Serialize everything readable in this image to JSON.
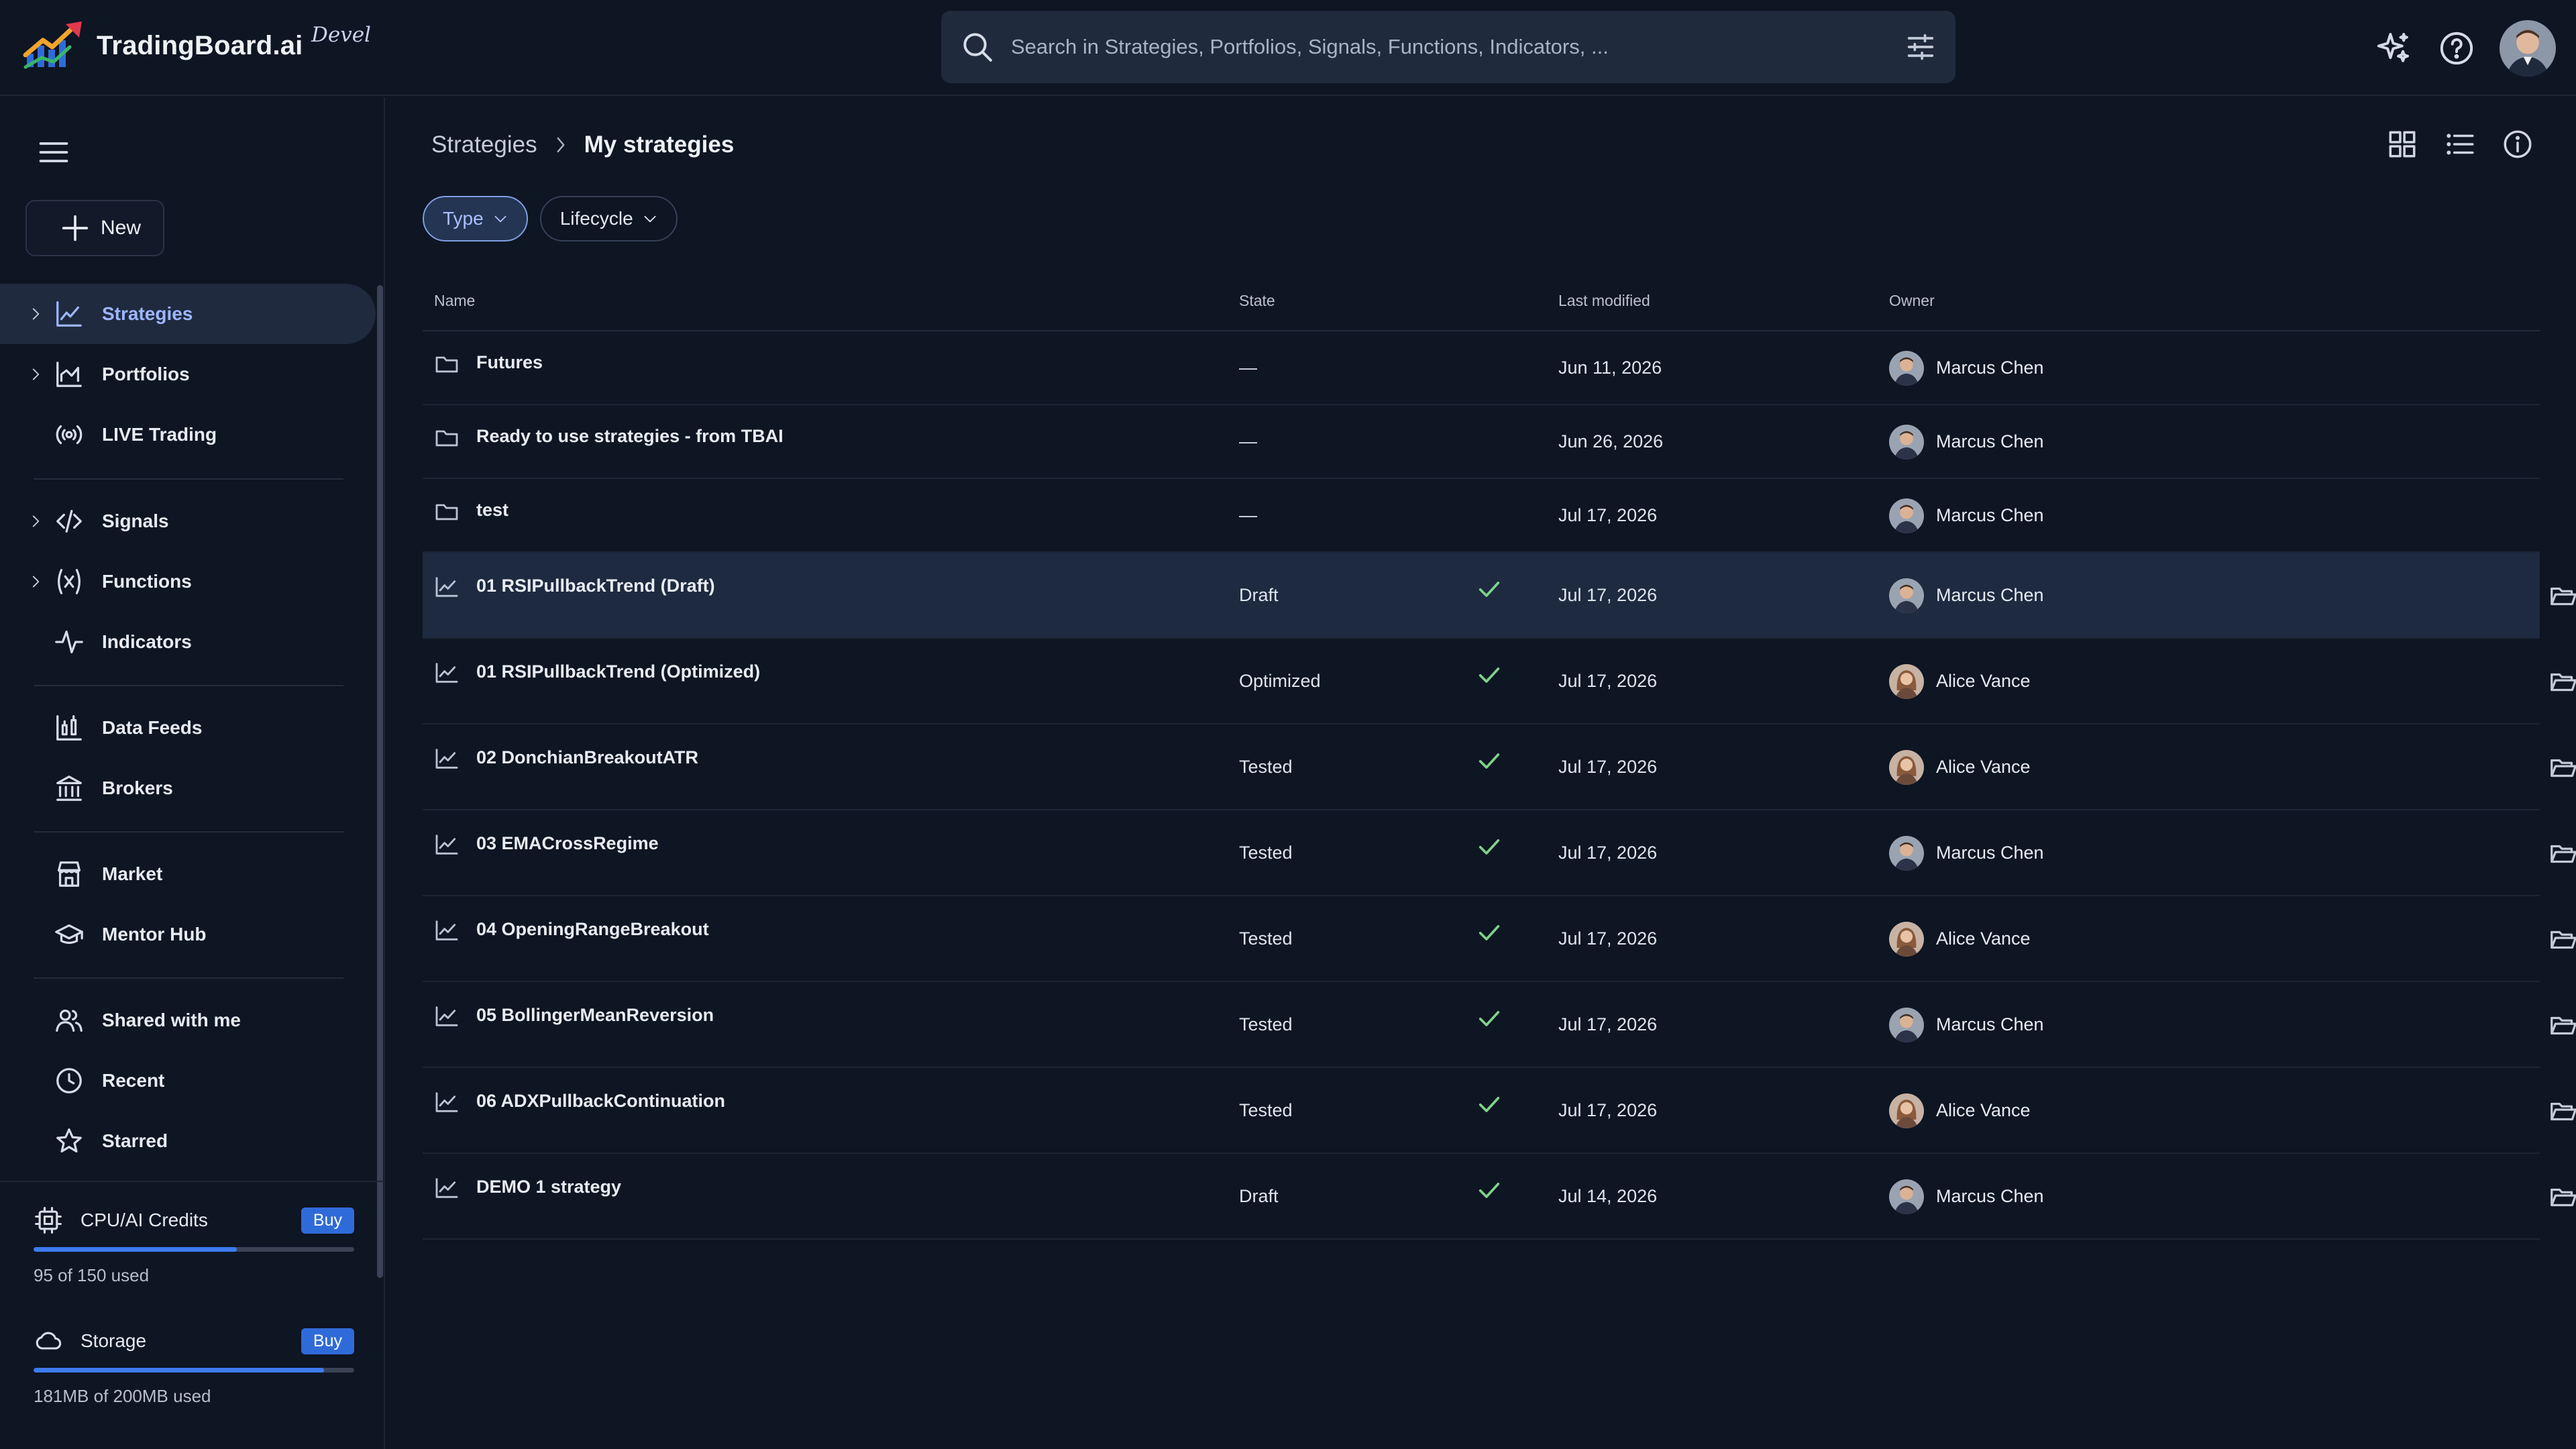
{
  "app": {
    "name": "TradingBoard.ai",
    "env": "Devel",
    "accent": "#3d7bf0",
    "logo_colors": [
      "#2f6bd8",
      "#e2384d",
      "#f0a52b",
      "#38b56a"
    ]
  },
  "search": {
    "placeholder": "Search in Strategies, Portfolios, Signals, Functions, Indicators, ...",
    "value": "",
    "icon": "search-icon",
    "filter_icon": "filter-settings-icon"
  },
  "header_actions": [
    "ai-sparkle-icon",
    "help-icon",
    "user-avatar"
  ],
  "sidebar": {
    "new_label": "New",
    "items": [
      {
        "label": "Strategies",
        "icon": "strategy-chart-icon",
        "expandable": true,
        "active": true
      },
      {
        "label": "Portfolios",
        "icon": "portfolio-chart-icon",
        "expandable": true
      },
      {
        "label": "LIVE Trading",
        "icon": "broadcast-icon",
        "expandable": false
      },
      {
        "label": "Signals",
        "icon": "code-icon",
        "expandable": true
      },
      {
        "label": "Functions",
        "icon": "function-icon",
        "expandable": true
      },
      {
        "label": "Indicators",
        "icon": "pulse-icon",
        "expandable": false
      },
      {
        "label": "Data Feeds",
        "icon": "data-feeds-icon",
        "expandable": false
      },
      {
        "label": "Brokers",
        "icon": "bank-icon",
        "expandable": false
      },
      {
        "label": "Market",
        "icon": "store-icon",
        "expandable": false
      },
      {
        "label": "Mentor Hub",
        "icon": "graduation-cap-icon",
        "expandable": false
      },
      {
        "label": "Shared with me",
        "icon": "people-icon",
        "expandable": false
      },
      {
        "label": "Recent",
        "icon": "clock-icon",
        "expandable": false
      },
      {
        "label": "Starred",
        "icon": "star-icon",
        "expandable": false
      }
    ],
    "quotas": [
      {
        "label": "CPU/AI Credits",
        "icon": "cpu-icon",
        "buy_label": "Buy",
        "used_text": "95 of 150 used",
        "fraction": 0.633
      },
      {
        "label": "Storage",
        "icon": "cloud-icon",
        "buy_label": "Buy",
        "used_text": "181MB of 200MB used",
        "fraction": 0.905
      }
    ]
  },
  "breadcrumb": {
    "parent": "Strategies",
    "current": "My strategies"
  },
  "view_actions": [
    "grid-view-icon",
    "list-view-icon",
    "info-icon"
  ],
  "filters": [
    {
      "label": "Type",
      "active": true
    },
    {
      "label": "Lifecycle",
      "active": false
    }
  ],
  "table": {
    "columns": [
      "Name",
      "State",
      "Last modified",
      "Owner"
    ],
    "rows": [
      {
        "kind": "folder",
        "name": "Futures",
        "state": "—",
        "validated": false,
        "modified": "Jun 11, 2026",
        "owner": "Marcus Chen",
        "avatar": "m",
        "selected": false
      },
      {
        "kind": "folder",
        "name": "Ready to use strategies - from TBAI",
        "state": "—",
        "validated": false,
        "modified": "Jun 26, 2026",
        "owner": "Marcus Chen",
        "avatar": "m",
        "selected": false
      },
      {
        "kind": "folder",
        "name": "test",
        "state": "—",
        "validated": false,
        "modified": "Jul 17, 2026",
        "owner": "Marcus Chen",
        "avatar": "m",
        "selected": false
      },
      {
        "kind": "strategy",
        "name": "01 RSIPullbackTrend (Draft)",
        "state": "Draft",
        "validated": true,
        "modified": "Jul 17, 2026",
        "owner": "Marcus Chen",
        "avatar": "m",
        "selected": true
      },
      {
        "kind": "strategy",
        "name": "01 RSIPullbackTrend (Optimized)",
        "state": "Optimized",
        "validated": true,
        "modified": "Jul 17, 2026",
        "owner": "Alice Vance",
        "avatar": "f",
        "selected": false
      },
      {
        "kind": "strategy",
        "name": "02 DonchianBreakoutATR",
        "state": "Tested",
        "validated": true,
        "modified": "Jul 17, 2026",
        "owner": "Alice Vance",
        "avatar": "f",
        "selected": false
      },
      {
        "kind": "strategy",
        "name": "03 EMACrossRegime",
        "state": "Tested",
        "validated": true,
        "modified": "Jul 17, 2026",
        "owner": "Marcus Chen",
        "avatar": "m",
        "selected": false
      },
      {
        "kind": "strategy",
        "name": "04 OpeningRangeBreakout",
        "state": "Tested",
        "validated": true,
        "modified": "Jul 17, 2026",
        "owner": "Alice Vance",
        "avatar": "f",
        "selected": false
      },
      {
        "kind": "strategy",
        "name": "05 BollingerMeanReversion",
        "state": "Tested",
        "validated": true,
        "modified": "Jul 17, 2026",
        "owner": "Marcus Chen",
        "avatar": "m",
        "selected": false
      },
      {
        "kind": "strategy",
        "name": "06 ADXPullbackContinuation",
        "state": "Tested",
        "validated": true,
        "modified": "Jul 17, 2026",
        "owner": "Alice Vance",
        "avatar": "f",
        "selected": false
      },
      {
        "kind": "strategy",
        "name": "DEMO 1 strategy",
        "state": "Draft",
        "validated": true,
        "modified": "Jul 14, 2026",
        "owner": "Marcus Chen",
        "avatar": "m",
        "selected": false
      }
    ]
  }
}
